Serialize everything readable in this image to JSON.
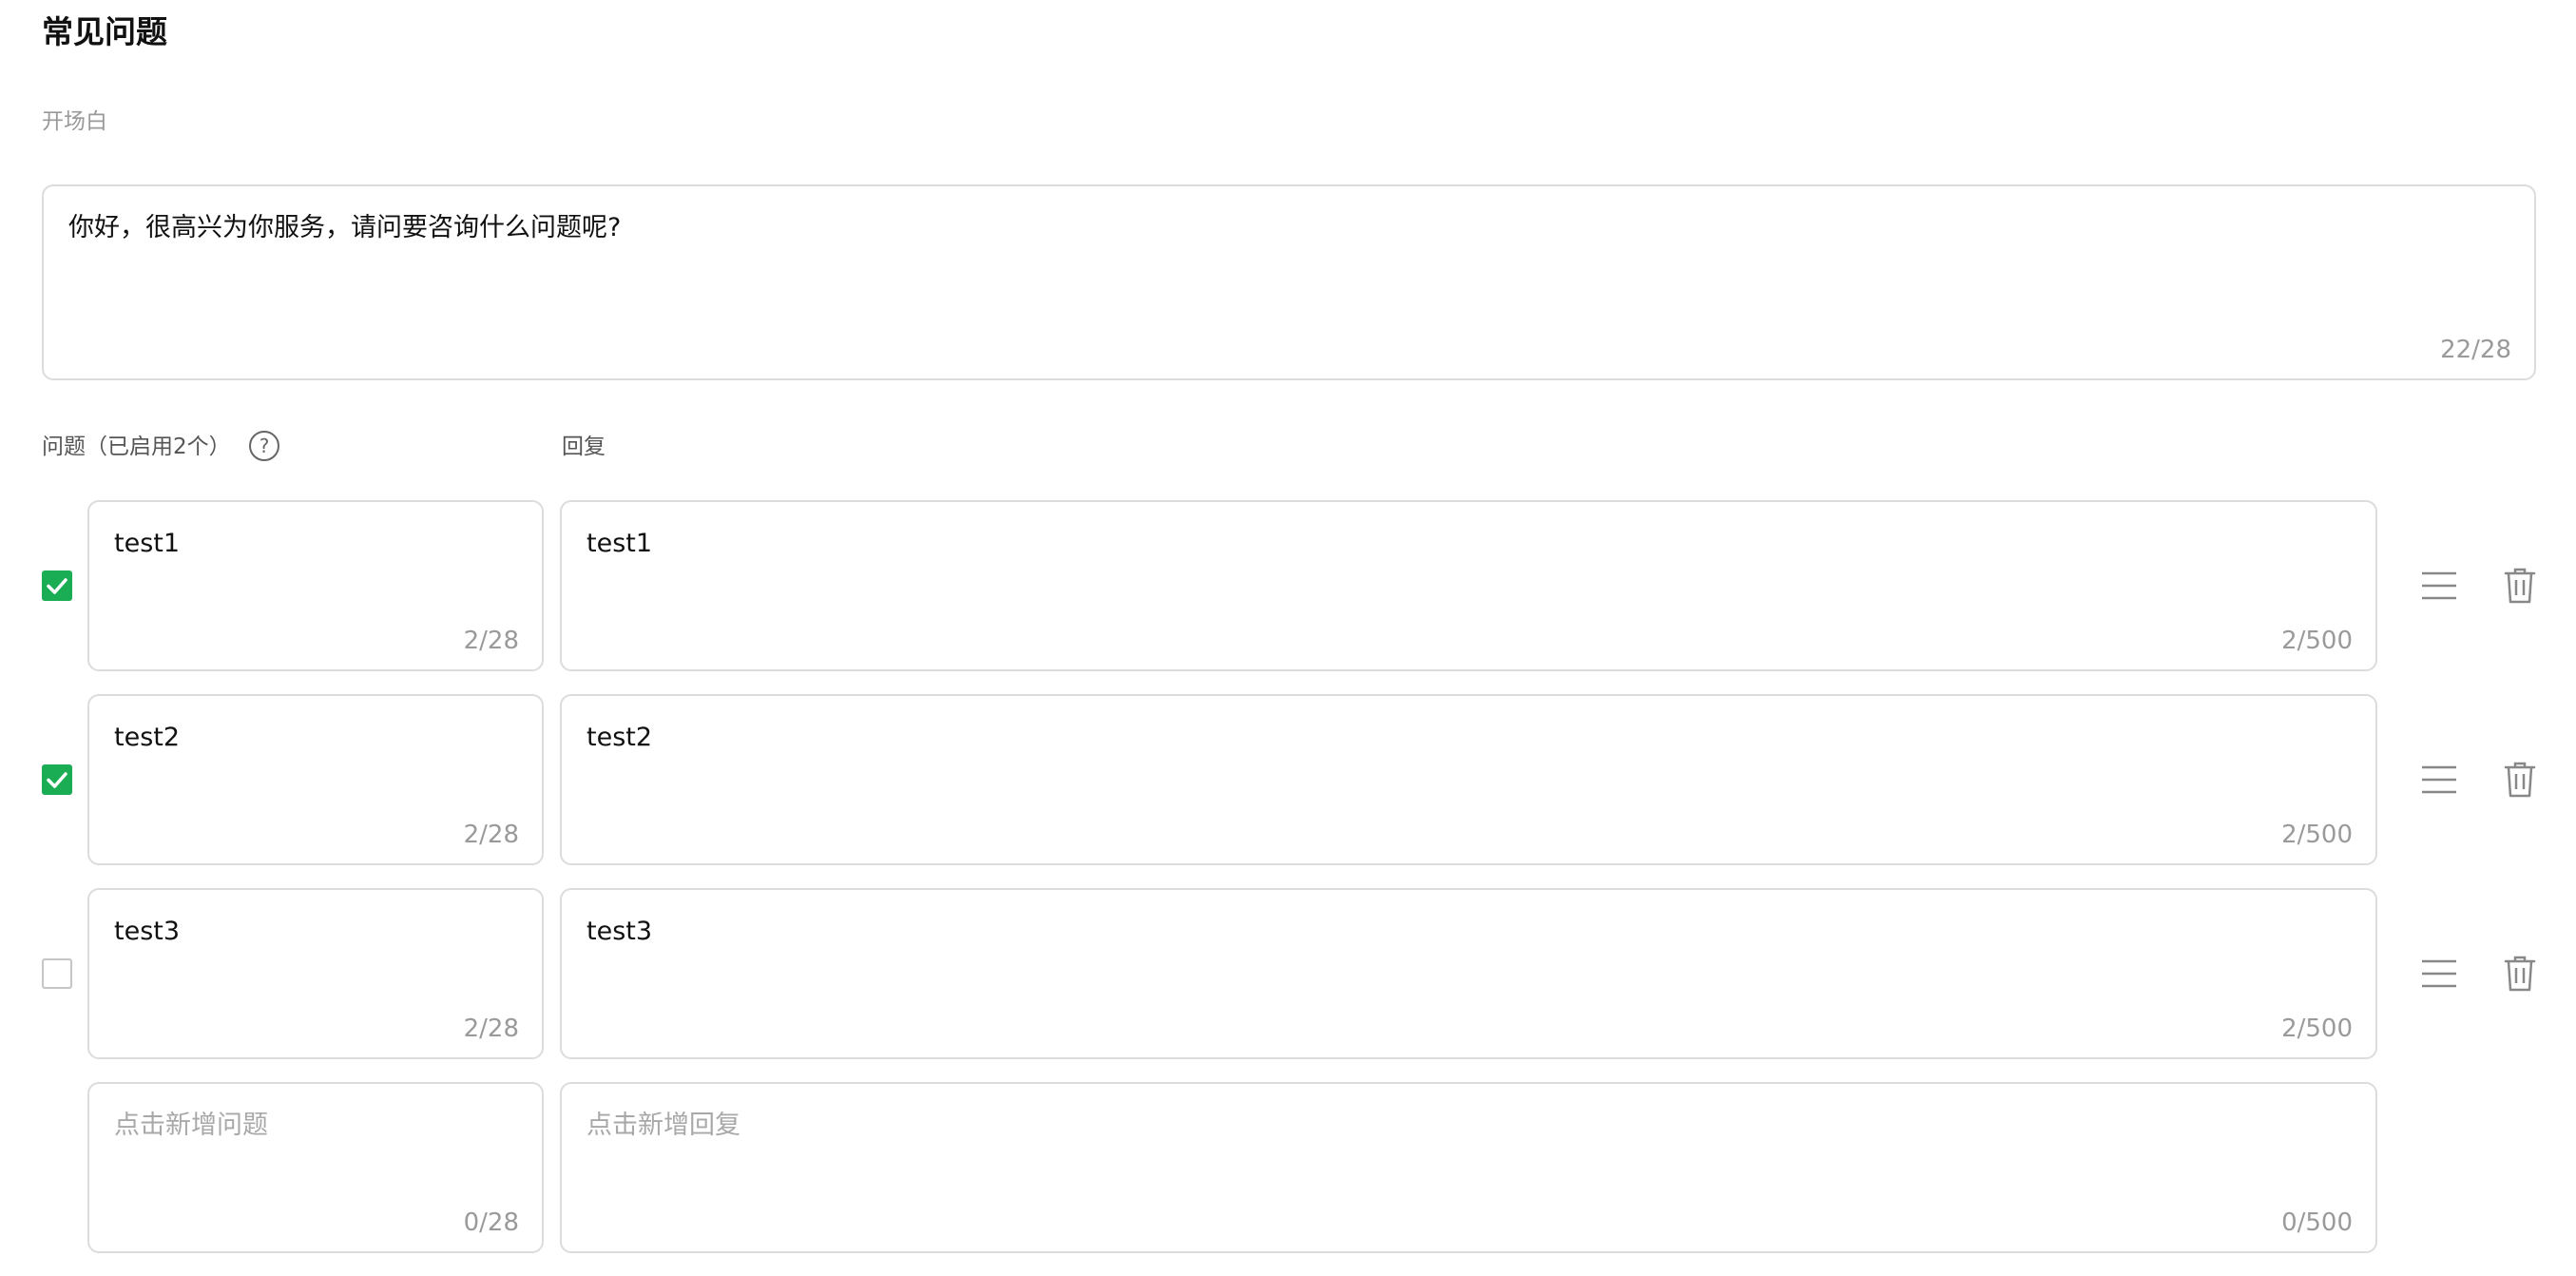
{
  "page": {
    "title": "常见问题",
    "opening_label": "开场白"
  },
  "opening": {
    "text": "你好，很高兴为你服务，请问要咨询什么问题呢?",
    "counter": "22/28"
  },
  "columns": {
    "question_header": "问题（已启用2个）",
    "reply_header": "回复"
  },
  "faq_rows": [
    {
      "enabled": true,
      "question": "test1",
      "question_counter": "2/28",
      "reply": "test1",
      "reply_counter": "2/500"
    },
    {
      "enabled": true,
      "question": "test2",
      "question_counter": "2/28",
      "reply": "test2",
      "reply_counter": "2/500"
    },
    {
      "enabled": false,
      "question": "test3",
      "question_counter": "2/28",
      "reply": "test3",
      "reply_counter": "2/500"
    }
  ],
  "new_row": {
    "question_placeholder": "点击新增问题",
    "question_counter": "0/28",
    "reply_placeholder": "点击新增回复",
    "reply_counter": "0/500"
  },
  "colors": {
    "accent_green": "#1aad53",
    "border": "#dcdcdc",
    "muted_text": "#999999"
  },
  "icons": {
    "help": "question-circle-icon",
    "checkbox": "check-icon",
    "drag": "drag-handle-icon",
    "delete": "trash-icon"
  }
}
